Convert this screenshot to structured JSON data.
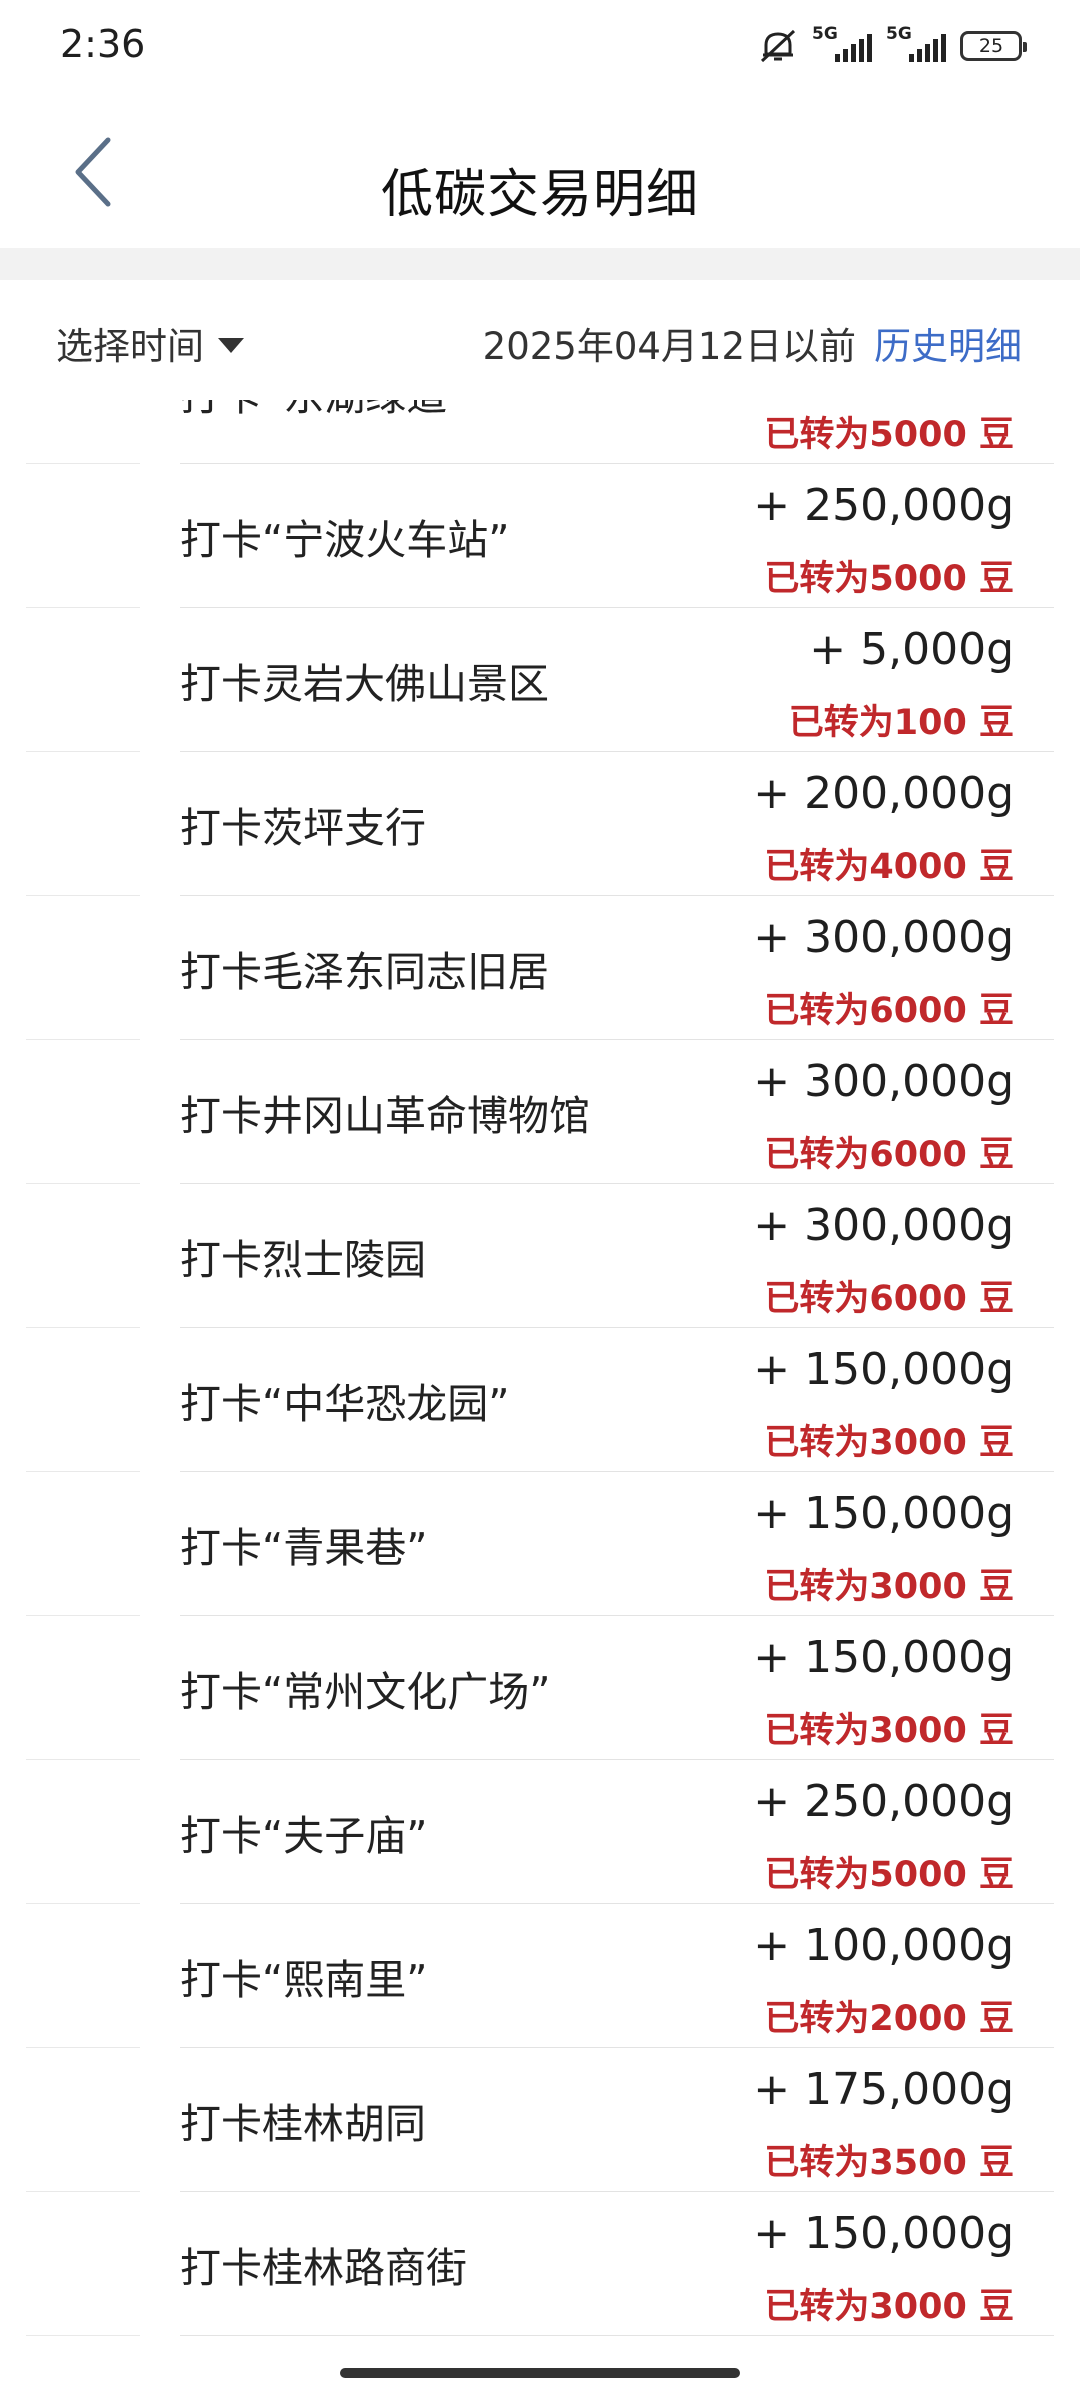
{
  "status_bar": {
    "time": "2:36",
    "signal1": "5G",
    "signal2": "5G",
    "battery": "25"
  },
  "header": {
    "title": "低碳交易明细"
  },
  "filter": {
    "select_label": "选择时间",
    "date_text": "2025年04月12日以前",
    "history_link": "历史明细"
  },
  "colors": {
    "accent_link": "#3d6cc7",
    "converted_red": "#c0282b"
  },
  "records": [
    {
      "title": "打卡“东湖绿道”",
      "amount": "",
      "status": "已转为5000 豆"
    },
    {
      "title": "打卡“宁波火车站”",
      "amount": "+ 250,000g",
      "status": "已转为5000 豆"
    },
    {
      "title": "打卡灵岩大佛山景区",
      "amount": "+ 5,000g",
      "status": "已转为100 豆"
    },
    {
      "title": "打卡茨坪支行",
      "amount": "+ 200,000g",
      "status": "已转为4000 豆"
    },
    {
      "title": "打卡毛泽东同志旧居",
      "amount": "+ 300,000g",
      "status": "已转为6000 豆"
    },
    {
      "title": "打卡井冈山革命博物馆",
      "amount": "+ 300,000g",
      "status": "已转为6000 豆"
    },
    {
      "title": "打卡烈士陵园",
      "amount": "+ 300,000g",
      "status": "已转为6000 豆"
    },
    {
      "title": "打卡“中华恐龙园”",
      "amount": "+ 150,000g",
      "status": "已转为3000 豆"
    },
    {
      "title": "打卡“青果巷”",
      "amount": "+ 150,000g",
      "status": "已转为3000 豆"
    },
    {
      "title": "打卡“常州文化广场”",
      "amount": "+ 150,000g",
      "status": "已转为3000 豆"
    },
    {
      "title": "打卡“夫子庙”",
      "amount": "+ 250,000g",
      "status": "已转为5000 豆"
    },
    {
      "title": "打卡“熙南里”",
      "amount": "+ 100,000g",
      "status": "已转为2000 豆"
    },
    {
      "title": "打卡桂林胡同",
      "amount": "+ 175,000g",
      "status": "已转为3500 豆"
    },
    {
      "title": "打卡桂林路商街",
      "amount": "+ 150,000g",
      "status": "已转为3000 豆"
    }
  ]
}
